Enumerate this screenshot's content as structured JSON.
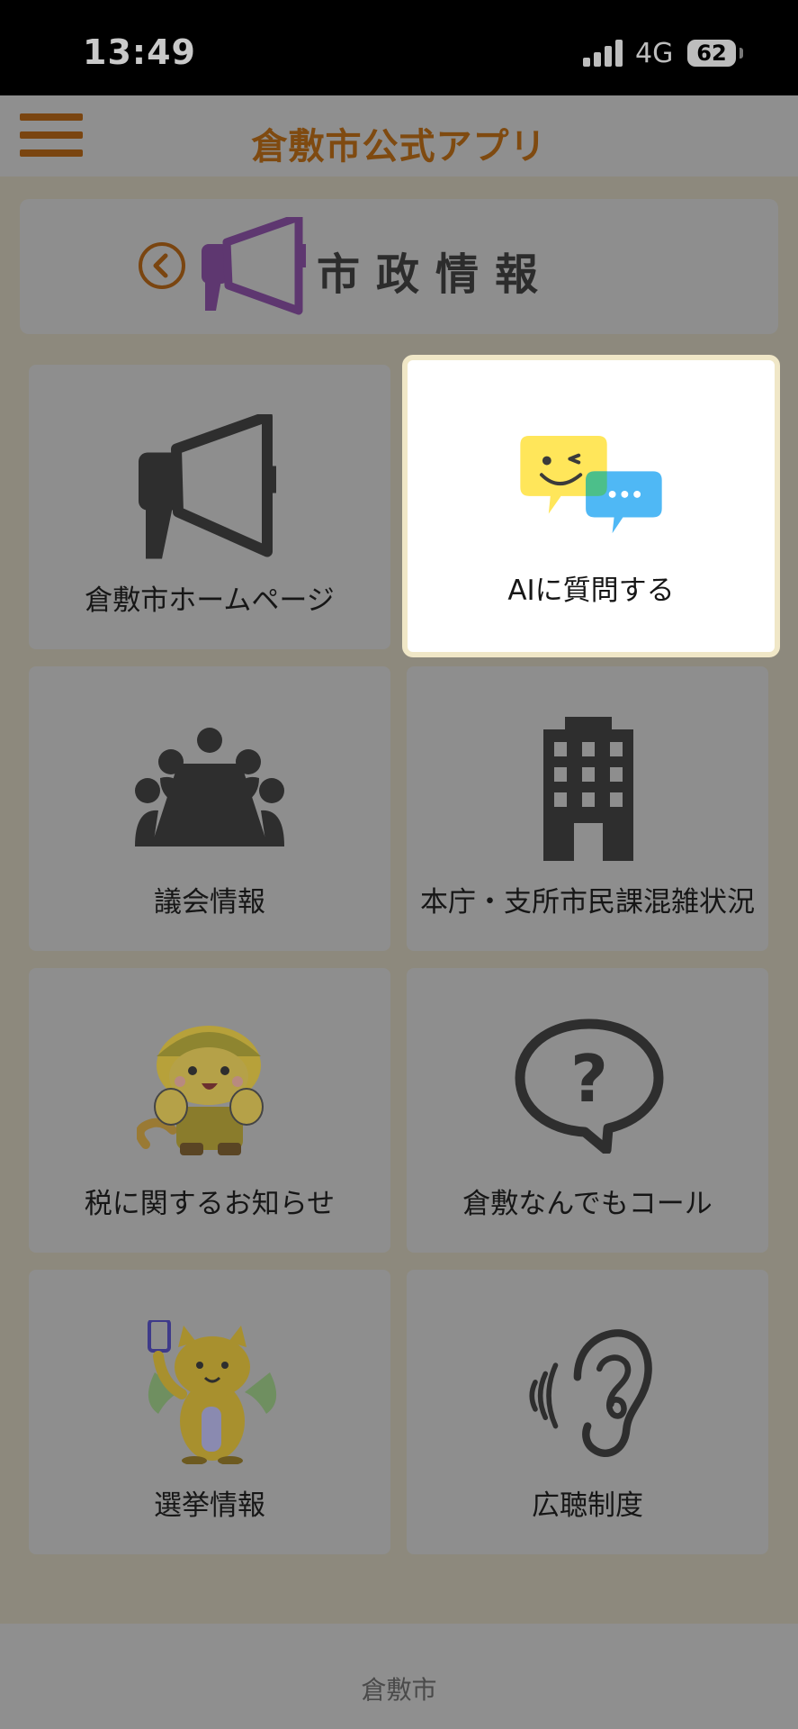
{
  "status": {
    "time": "13:49",
    "network": "4G",
    "battery": "62"
  },
  "header": {
    "title": "倉敷市公式アプリ"
  },
  "section": {
    "title": "市政情報"
  },
  "tiles": [
    {
      "label": "倉敷市ホームページ",
      "icon": "megaphone-icon"
    },
    {
      "label": "AIに質問する",
      "icon": "chat-bubbles-icon"
    },
    {
      "label": "議会情報",
      "icon": "meeting-icon"
    },
    {
      "label": "本庁・支所市民課混雑状況",
      "icon": "building-icon"
    },
    {
      "label": "税に関するお知らせ",
      "icon": "cat-mascot-icon"
    },
    {
      "label": "倉敷なんでもコール",
      "icon": "question-bubble-icon"
    },
    {
      "label": "選挙情報",
      "icon": "cat-election-mascot-icon"
    },
    {
      "label": "広聴制度",
      "icon": "ear-icon"
    }
  ],
  "footer": {
    "label": "倉敷市"
  },
  "colors": {
    "brand": "#7f4a10",
    "overlay": "#8e8e8e",
    "highlight_border": "#f0e7c7"
  }
}
